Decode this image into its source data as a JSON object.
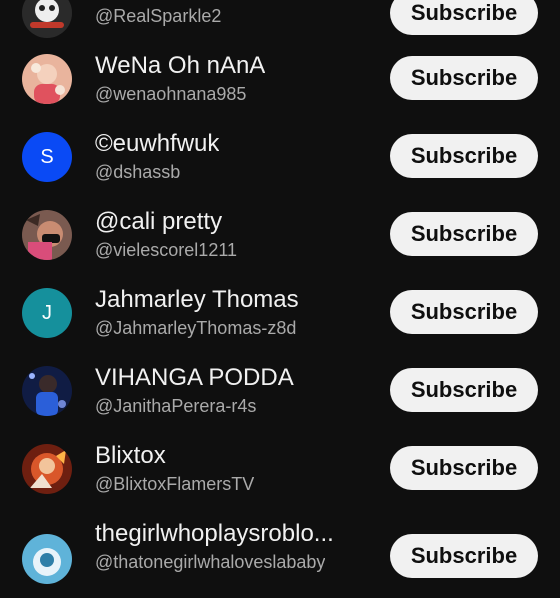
{
  "subscribe_label": "Subscribe",
  "channels": [
    {
      "name": "",
      "handle": "@RealSparkle2",
      "avatar_text": "",
      "avatar_color": "#222222"
    },
    {
      "name": "WeNa Oh nAnA",
      "handle": "@wenaohnana985",
      "avatar_text": "",
      "avatar_color": "#d98a78"
    },
    {
      "name": "©euwhfwuk",
      "handle": "@dshassb",
      "avatar_text": "S",
      "avatar_color": "#0a4af5"
    },
    {
      "name": "@cali pretty",
      "handle": "@vielescorel1211",
      "avatar_text": "",
      "avatar_color": "#6b3e3a"
    },
    {
      "name": "Jahmarley Thomas",
      "handle": "@JahmarleyThomas-z8d",
      "avatar_text": "J",
      "avatar_color": "#15909c"
    },
    {
      "name": "VIHANGA PODDA",
      "handle": "@JanithaPerera-r4s",
      "avatar_text": "",
      "avatar_color": "#1c2e66"
    },
    {
      "name": "Blixtox",
      "handle": "@BlixtoxFlamersTV",
      "avatar_text": "",
      "avatar_color": "#a33a1c"
    },
    {
      "name": "thegirlwhoplaysroblo...",
      "handle": "@thatonegirlwhaloveslababy",
      "avatar_text": "",
      "avatar_color": "#3a8fb8"
    }
  ]
}
